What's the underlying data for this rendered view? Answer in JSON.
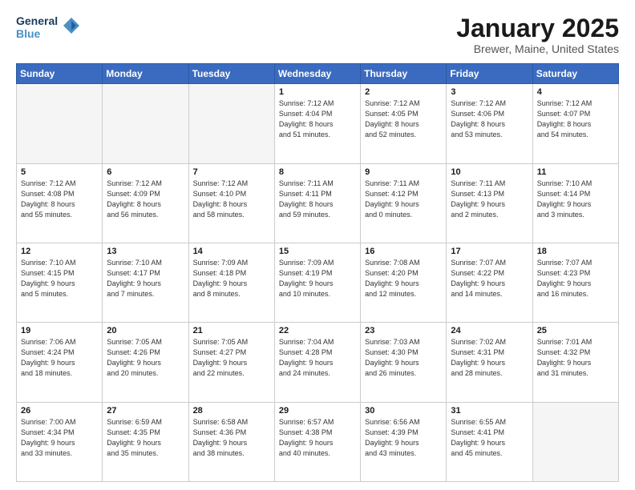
{
  "header": {
    "logo": {
      "line1": "General",
      "line2": "Blue"
    },
    "title": "January 2025",
    "subtitle": "Brewer, Maine, United States"
  },
  "weekdays": [
    "Sunday",
    "Monday",
    "Tuesday",
    "Wednesday",
    "Thursday",
    "Friday",
    "Saturday"
  ],
  "weeks": [
    [
      {
        "day": "",
        "info": ""
      },
      {
        "day": "",
        "info": ""
      },
      {
        "day": "",
        "info": ""
      },
      {
        "day": "1",
        "info": "Sunrise: 7:12 AM\nSunset: 4:04 PM\nDaylight: 8 hours\nand 51 minutes."
      },
      {
        "day": "2",
        "info": "Sunrise: 7:12 AM\nSunset: 4:05 PM\nDaylight: 8 hours\nand 52 minutes."
      },
      {
        "day": "3",
        "info": "Sunrise: 7:12 AM\nSunset: 4:06 PM\nDaylight: 8 hours\nand 53 minutes."
      },
      {
        "day": "4",
        "info": "Sunrise: 7:12 AM\nSunset: 4:07 PM\nDaylight: 8 hours\nand 54 minutes."
      }
    ],
    [
      {
        "day": "5",
        "info": "Sunrise: 7:12 AM\nSunset: 4:08 PM\nDaylight: 8 hours\nand 55 minutes."
      },
      {
        "day": "6",
        "info": "Sunrise: 7:12 AM\nSunset: 4:09 PM\nDaylight: 8 hours\nand 56 minutes."
      },
      {
        "day": "7",
        "info": "Sunrise: 7:12 AM\nSunset: 4:10 PM\nDaylight: 8 hours\nand 58 minutes."
      },
      {
        "day": "8",
        "info": "Sunrise: 7:11 AM\nSunset: 4:11 PM\nDaylight: 8 hours\nand 59 minutes."
      },
      {
        "day": "9",
        "info": "Sunrise: 7:11 AM\nSunset: 4:12 PM\nDaylight: 9 hours\nand 0 minutes."
      },
      {
        "day": "10",
        "info": "Sunrise: 7:11 AM\nSunset: 4:13 PM\nDaylight: 9 hours\nand 2 minutes."
      },
      {
        "day": "11",
        "info": "Sunrise: 7:10 AM\nSunset: 4:14 PM\nDaylight: 9 hours\nand 3 minutes."
      }
    ],
    [
      {
        "day": "12",
        "info": "Sunrise: 7:10 AM\nSunset: 4:15 PM\nDaylight: 9 hours\nand 5 minutes."
      },
      {
        "day": "13",
        "info": "Sunrise: 7:10 AM\nSunset: 4:17 PM\nDaylight: 9 hours\nand 7 minutes."
      },
      {
        "day": "14",
        "info": "Sunrise: 7:09 AM\nSunset: 4:18 PM\nDaylight: 9 hours\nand 8 minutes."
      },
      {
        "day": "15",
        "info": "Sunrise: 7:09 AM\nSunset: 4:19 PM\nDaylight: 9 hours\nand 10 minutes."
      },
      {
        "day": "16",
        "info": "Sunrise: 7:08 AM\nSunset: 4:20 PM\nDaylight: 9 hours\nand 12 minutes."
      },
      {
        "day": "17",
        "info": "Sunrise: 7:07 AM\nSunset: 4:22 PM\nDaylight: 9 hours\nand 14 minutes."
      },
      {
        "day": "18",
        "info": "Sunrise: 7:07 AM\nSunset: 4:23 PM\nDaylight: 9 hours\nand 16 minutes."
      }
    ],
    [
      {
        "day": "19",
        "info": "Sunrise: 7:06 AM\nSunset: 4:24 PM\nDaylight: 9 hours\nand 18 minutes."
      },
      {
        "day": "20",
        "info": "Sunrise: 7:05 AM\nSunset: 4:26 PM\nDaylight: 9 hours\nand 20 minutes."
      },
      {
        "day": "21",
        "info": "Sunrise: 7:05 AM\nSunset: 4:27 PM\nDaylight: 9 hours\nand 22 minutes."
      },
      {
        "day": "22",
        "info": "Sunrise: 7:04 AM\nSunset: 4:28 PM\nDaylight: 9 hours\nand 24 minutes."
      },
      {
        "day": "23",
        "info": "Sunrise: 7:03 AM\nSunset: 4:30 PM\nDaylight: 9 hours\nand 26 minutes."
      },
      {
        "day": "24",
        "info": "Sunrise: 7:02 AM\nSunset: 4:31 PM\nDaylight: 9 hours\nand 28 minutes."
      },
      {
        "day": "25",
        "info": "Sunrise: 7:01 AM\nSunset: 4:32 PM\nDaylight: 9 hours\nand 31 minutes."
      }
    ],
    [
      {
        "day": "26",
        "info": "Sunrise: 7:00 AM\nSunset: 4:34 PM\nDaylight: 9 hours\nand 33 minutes."
      },
      {
        "day": "27",
        "info": "Sunrise: 6:59 AM\nSunset: 4:35 PM\nDaylight: 9 hours\nand 35 minutes."
      },
      {
        "day": "28",
        "info": "Sunrise: 6:58 AM\nSunset: 4:36 PM\nDaylight: 9 hours\nand 38 minutes."
      },
      {
        "day": "29",
        "info": "Sunrise: 6:57 AM\nSunset: 4:38 PM\nDaylight: 9 hours\nand 40 minutes."
      },
      {
        "day": "30",
        "info": "Sunrise: 6:56 AM\nSunset: 4:39 PM\nDaylight: 9 hours\nand 43 minutes."
      },
      {
        "day": "31",
        "info": "Sunrise: 6:55 AM\nSunset: 4:41 PM\nDaylight: 9 hours\nand 45 minutes."
      },
      {
        "day": "",
        "info": ""
      }
    ]
  ]
}
